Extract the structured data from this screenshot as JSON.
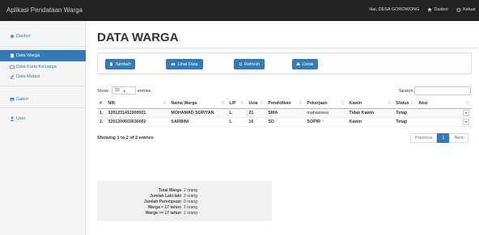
{
  "navbar": {
    "brand": "Aplikasi Pendataan Warga",
    "user_label": "Hai, DESA GOROWONG",
    "dashboard_label": "Dasbor",
    "logout_label": "Keluar"
  },
  "sidebar": {
    "items": [
      {
        "label": "Dasbor",
        "icon": "home-icon"
      },
      {
        "label": "Data Warga",
        "icon": "file-icon"
      },
      {
        "label": "Data Kartu Keluarga",
        "icon": "card-icon"
      },
      {
        "label": "Data Mutasi",
        "icon": "edit-icon"
      },
      {
        "label": "Galeri",
        "icon": "image-icon"
      },
      {
        "label": "User",
        "icon": "user-icon"
      }
    ]
  },
  "page": {
    "title": "DATA WARGA"
  },
  "toolbar": {
    "tambah": "Tambah",
    "lihat": "Lihat Data",
    "refresh": "Refresh",
    "cetak": "Cetak"
  },
  "table_controls": {
    "show_label": "Show",
    "show_value": "10",
    "entries_label": "entries",
    "search_label": "Search:"
  },
  "table": {
    "headers": [
      "#",
      "NIK",
      "Nama Warga",
      "L/P",
      "Usia",
      "Pendidikan",
      "Pekerjaan",
      "Kawin",
      "Status",
      "Aksi"
    ],
    "rows": [
      {
        "no": "1.",
        "nik": "3201231411000001",
        "nama": "MOHAMAD SOPIYAN",
        "lp": "L",
        "usia": "21",
        "pendidikan": "SMA",
        "pekerjaan": "mahasiswa",
        "kawin": "Tidak Kawin",
        "status": "Tetap"
      },
      {
        "no": "2.",
        "nik": "3201200603630002",
        "nama": "SARBINI",
        "lp": "L",
        "usia": "16",
        "pendidikan": "SD",
        "pekerjaan": "SOPIR",
        "kawin": "Kawin",
        "status": "Tetap"
      }
    ]
  },
  "table_info": "Showing 1 to 2 of 2 entries",
  "pagination": {
    "previous": "Previous",
    "current": "1",
    "next": "Next"
  },
  "summary": [
    {
      "label": "Total Warga",
      "value": "2 orang"
    },
    {
      "label": "Jumlah Laki-laki",
      "value": "2 orang"
    },
    {
      "label": "Jumlah Perempuan",
      "value": "0 orang"
    },
    {
      "label": "Warga < 17 tahun",
      "value": "1 orang"
    },
    {
      "label": "Warga >= 17 tahun",
      "value": "1 orang"
    }
  ],
  "colors": {
    "primary": "#337ab7",
    "navbar": "#222222"
  }
}
